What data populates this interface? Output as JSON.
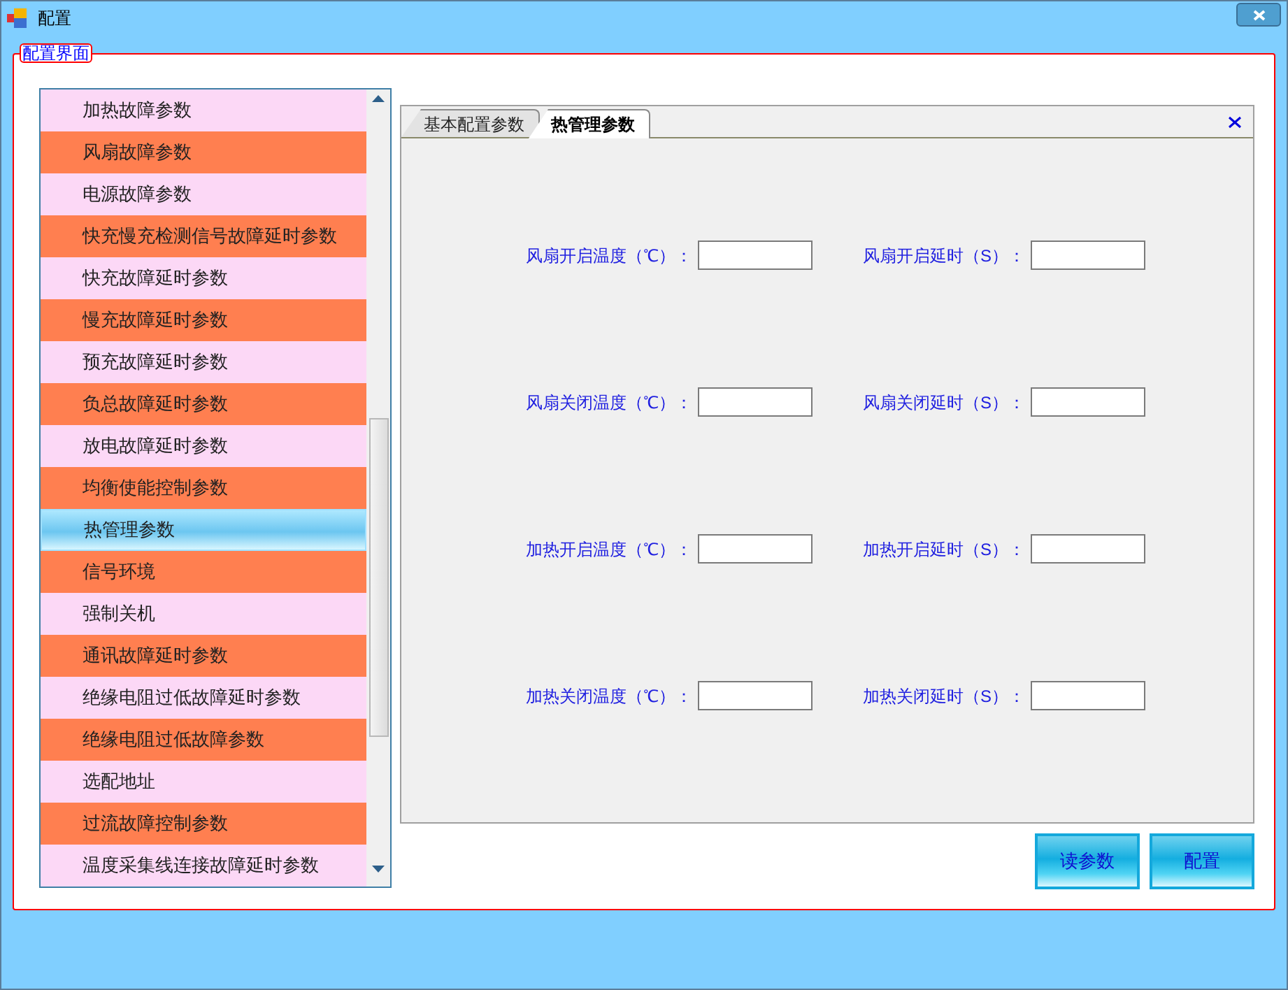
{
  "window": {
    "title": "配置"
  },
  "group": {
    "title": "配置界面"
  },
  "list": {
    "items": [
      {
        "label": "加热故障参数",
        "selected": false
      },
      {
        "label": "风扇故障参数",
        "selected": false
      },
      {
        "label": "电源故障参数",
        "selected": false
      },
      {
        "label": "快充慢充检测信号故障延时参数",
        "selected": false
      },
      {
        "label": "快充故障延时参数",
        "selected": false
      },
      {
        "label": "慢充故障延时参数",
        "selected": false
      },
      {
        "label": "预充故障延时参数",
        "selected": false
      },
      {
        "label": "负总故障延时参数",
        "selected": false
      },
      {
        "label": "放电故障延时参数",
        "selected": false
      },
      {
        "label": "均衡使能控制参数",
        "selected": false
      },
      {
        "label": "热管理参数",
        "selected": true
      },
      {
        "label": "信号环境",
        "selected": false
      },
      {
        "label": "强制关机",
        "selected": false
      },
      {
        "label": "通讯故障延时参数",
        "selected": false
      },
      {
        "label": "绝缘电阻过低故障延时参数",
        "selected": false
      },
      {
        "label": "绝缘电阻过低故障参数",
        "selected": false
      },
      {
        "label": "选配地址",
        "selected": false
      },
      {
        "label": "过流故障控制参数",
        "selected": false
      },
      {
        "label": "温度采集线连接故障延时参数",
        "selected": false
      }
    ]
  },
  "tabs": [
    {
      "label": "基本配置参数",
      "selected": false
    },
    {
      "label": "热管理参数",
      "selected": true
    }
  ],
  "fields": [
    [
      {
        "label": "风扇开启温度（℃）："
      },
      {
        "label": "风扇开启延时（S）："
      }
    ],
    [
      {
        "label": "风扇关闭温度（℃）："
      },
      {
        "label": "风扇关闭延时（S）："
      }
    ],
    [
      {
        "label": "加热开启温度（℃）："
      },
      {
        "label": "加热开启延时（S）："
      }
    ],
    [
      {
        "label": "加热关闭温度（℃）："
      },
      {
        "label": "加热关闭延时（S）："
      }
    ]
  ],
  "buttons": [
    "读参数",
    "配置"
  ]
}
